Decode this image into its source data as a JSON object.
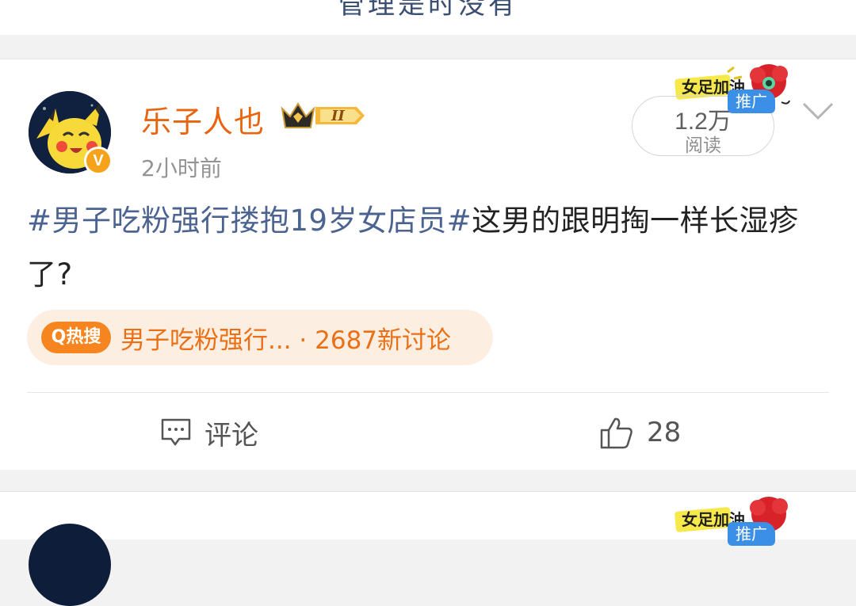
{
  "prev_card": {
    "footer_text": "管理是时没有"
  },
  "post": {
    "username": "乐子人也",
    "vip_level": "II",
    "verified_mark": "V",
    "timestamp": "2小时前",
    "read_count": "1.2万",
    "read_label": "阅读",
    "promo_tag": "推广",
    "ad_sticker_text": "女足加油",
    "text_hashtag": "#男子吃粉强行搂抱19岁女店员#",
    "text_body": "这男的跟明掏一样长湿疹了?",
    "hot_search": {
      "icon_label": "Q热搜",
      "topic": "男子吃粉强行...",
      "separator": "·",
      "discussion": "2687新讨论"
    },
    "actions": {
      "comment_label": "评论",
      "like_count": "28"
    }
  },
  "next_card": {
    "ad_sticker_text": "女足加油",
    "promo_tag": "推广"
  },
  "colors": {
    "username": "#e8640f",
    "hashtag": "#4b6390",
    "hot_text": "#ea7016",
    "hot_bg": "#fdeee2",
    "promo": "#3b8fe7"
  }
}
